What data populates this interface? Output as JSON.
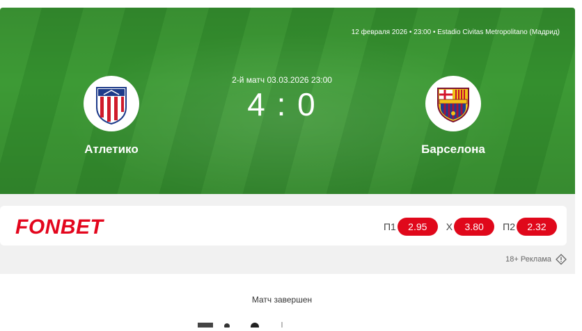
{
  "match": {
    "info_line": "12 февраля 2026 • 23:00 • Estadio Civitas Metropolitano (Мадрид)",
    "round_line": "2-й матч 03.03.2026 23:00",
    "score": "4 : 0",
    "home": {
      "name": "Атлетико",
      "crest_icon": "atletico-crest-icon"
    },
    "away": {
      "name": "Барселона",
      "crest_icon": "barcelona-crest-icon"
    }
  },
  "ad": {
    "brand": "FONBET",
    "odds": [
      {
        "label": "П1",
        "value": "2.95"
      },
      {
        "label": "Х",
        "value": "3.80"
      },
      {
        "label": "П2",
        "value": "2.32"
      }
    ],
    "note": "18+ Реклама"
  },
  "status": "Матч завершен",
  "colors": {
    "pitch": "#3d9a35",
    "brand_red": "#e0081b"
  }
}
